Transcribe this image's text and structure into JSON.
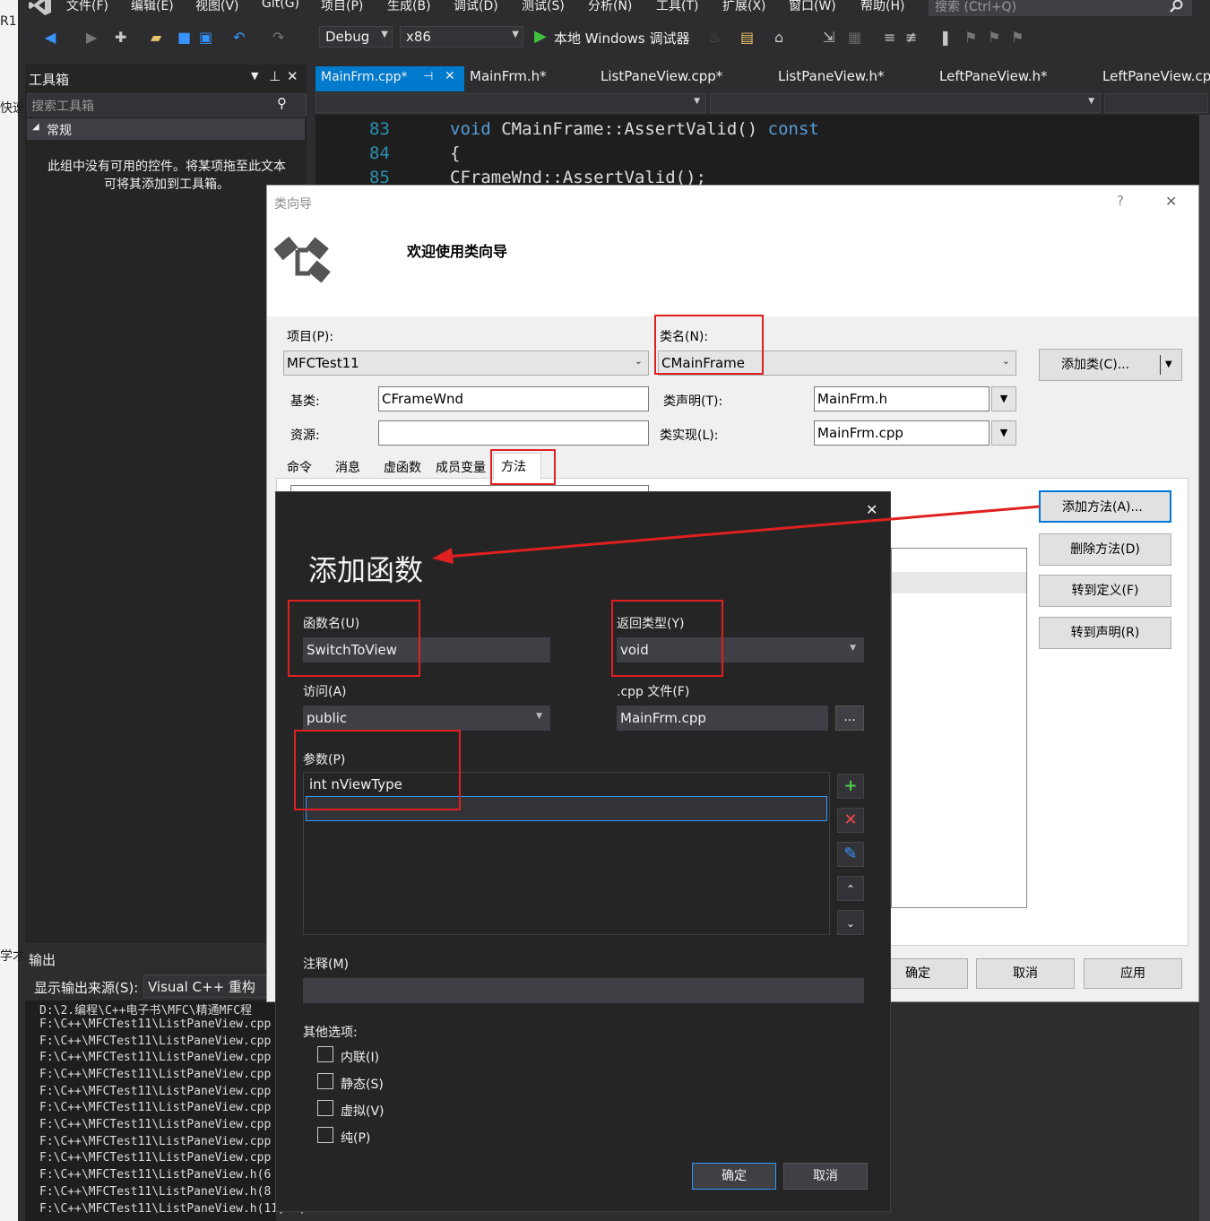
{
  "left_strip": {
    "top_text": "R1",
    "mid_text": "快速",
    "low_text": "学才"
  },
  "menubar": {
    "items": [
      "文件(F)",
      "编辑(E)",
      "视图(V)",
      "Git(G)",
      "项目(P)",
      "生成(B)",
      "调试(D)",
      "测试(S)",
      "分析(N)",
      "工具(T)",
      "扩展(X)",
      "窗口(W)",
      "帮助(H)"
    ],
    "search_placeholder": "搜索 (Ctrl+Q)"
  },
  "toolbar": {
    "config": "Debug",
    "platform": "x86",
    "run_label": "本地 Windows 调试器"
  },
  "toolbox": {
    "title": "工具箱",
    "search_placeholder": "搜索工具箱",
    "group": "常规",
    "empty_message_line1": "此组中没有可用的控件。将某项拖至此文本",
    "empty_message_line2": "可将其添加到工具箱。"
  },
  "output": {
    "title": "输出",
    "source_label": "显示输出来源(S):",
    "source_value": "Visual C++ 重构",
    "lines": [
      "D:\\2.编程\\C++电子书\\MFC\\精通MFC程",
      "F:\\C++\\MFCTest11\\ListPaneView.cpp",
      "F:\\C++\\MFCTest11\\ListPaneView.cpp",
      "F:\\C++\\MFCTest11\\ListPaneView.cpp",
      "F:\\C++\\MFCTest11\\ListPaneView.cpp",
      "F:\\C++\\MFCTest11\\ListPaneView.cpp",
      "F:\\C++\\MFCTest11\\ListPaneView.cpp",
      "F:\\C++\\MFCTest11\\ListPaneView.cpp",
      "F:\\C++\\MFCTest11\\ListPaneView.cpp",
      "F:\\C++\\MFCTest11\\ListPaneView.cpp",
      "F:\\C++\\MFCTest11\\ListPaneView.h(6",
      "F:\\C++\\MFCTest11\\ListPaneView.h(8",
      "F:\\C++\\MFCTest11\\ListPaneView.h(11, 2)"
    ]
  },
  "editor": {
    "tabs": [
      "MainFrm.cpp*",
      "MainFrm.h*",
      "ListPaneView.cpp*",
      "ListPaneView.h*",
      "LeftPaneView.h*",
      "LeftPaneView.cp"
    ],
    "code": [
      {
        "line": "83",
        "text_kw": "void",
        "text": " CMainFrame::AssertValid() ",
        "text_kw2": "const"
      },
      {
        "line": "84",
        "text": "{"
      },
      {
        "line": "85",
        "text": "    CFrameWnd::AssertValid();"
      }
    ]
  },
  "class_wizard": {
    "title": "类向导",
    "help": "?",
    "close": "✕",
    "welcome": "欢迎使用类向导",
    "project_label": "项目(P):",
    "project_value": "MFCTest11",
    "classname_label": "类名(N):",
    "classname_value": "CMainFrame",
    "add_class_button": "添加类(C)...",
    "base_label": "基类:",
    "base_value": "CFrameWnd",
    "resource_label": "资源:",
    "resource_value": "",
    "decl_label": "类声明(T):",
    "decl_value": "MainFrm.h",
    "impl_label": "类实现(L):",
    "impl_value": "MainFrm.cpp",
    "tabs": [
      "命令",
      "消息",
      "虚函数",
      "成员变量",
      "方法"
    ],
    "active_tab": "方法",
    "side_buttons": [
      "添加方法(A)...",
      "删除方法(D)",
      "转到定义(F)",
      "转到声明(R)"
    ],
    "footer_buttons": [
      "确定",
      "取消",
      "应用"
    ]
  },
  "add_function": {
    "close": "✕",
    "title": "添加函数",
    "name_label": "函数名(U)",
    "name_value": "SwitchToView",
    "return_label": "返回类型(Y)",
    "return_value": "void",
    "access_label": "访问(A)",
    "access_value": "public",
    "cpp_label": ".cpp 文件(F)",
    "cpp_value": "MainFrm.cpp",
    "cpp_browse": "...",
    "params_label": "参数(P)",
    "params": [
      "int nViewType"
    ],
    "comment_label": "注释(M)",
    "comment_value": "",
    "other_label": "其他选项:",
    "options": [
      {
        "label": "内联(I)",
        "checked": false
      },
      {
        "label": "静态(S)",
        "checked": false
      },
      {
        "label": "虚拟(V)",
        "checked": false
      },
      {
        "label": "纯(P)",
        "checked": false
      }
    ],
    "ok": "确定",
    "cancel": "取消"
  },
  "colors": {
    "accent": "#007acc",
    "annotation_red": "#e02020",
    "dark_bg": "#2d2d30",
    "dialog_light": "#f0f0f0"
  }
}
